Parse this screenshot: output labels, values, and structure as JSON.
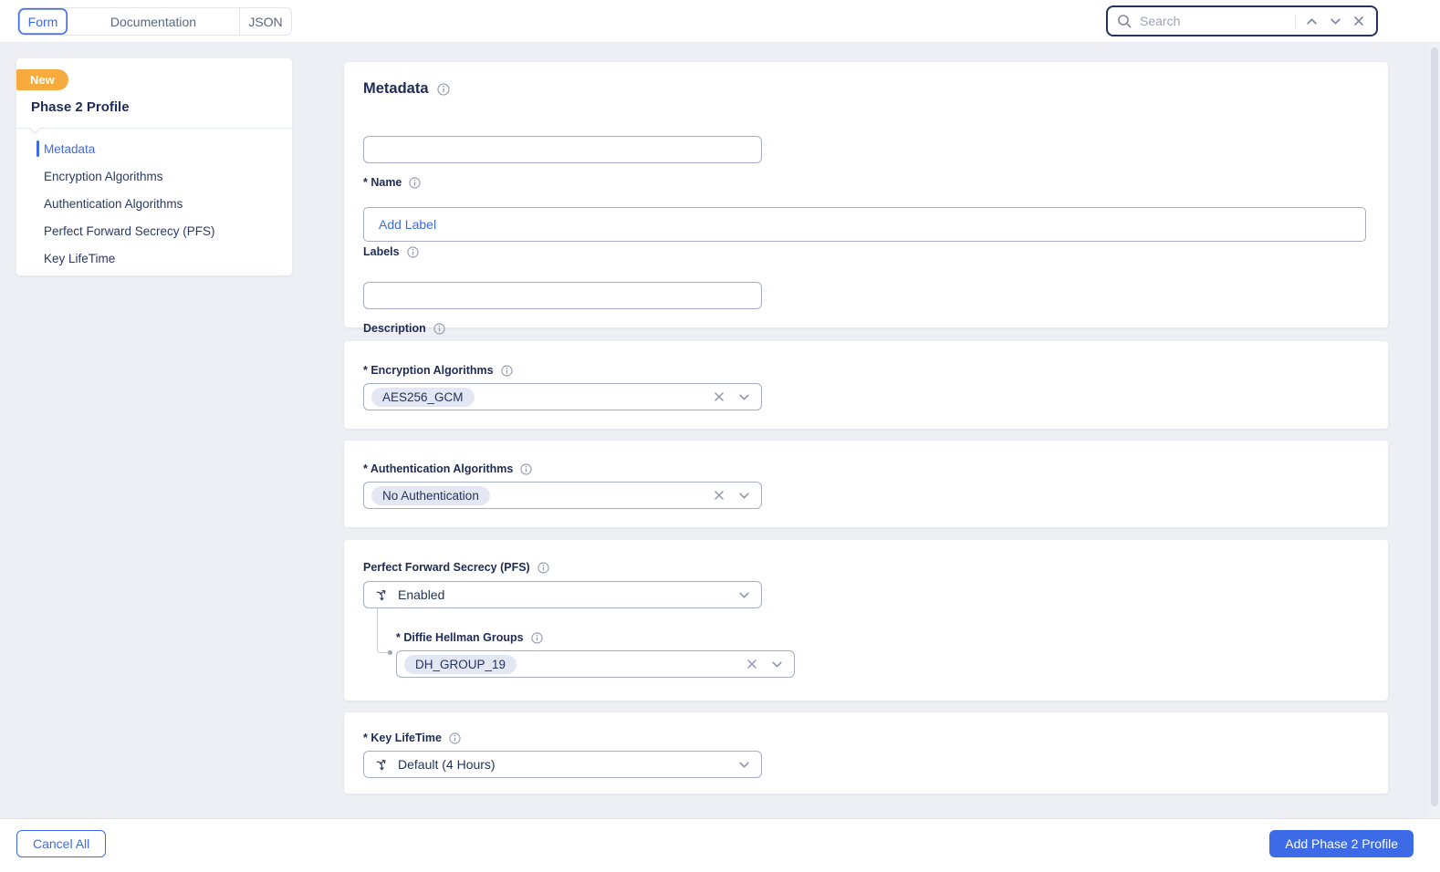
{
  "topbar": {
    "view_tabs": [
      {
        "label": "Form",
        "active": true
      },
      {
        "label": "Documentation",
        "active": false
      },
      {
        "label": "JSON",
        "active": false
      }
    ],
    "search": {
      "placeholder": "Search"
    }
  },
  "sidebar": {
    "badge": "New",
    "title": "Phase 2 Profile",
    "items": [
      {
        "label": "Metadata",
        "active": true
      },
      {
        "label": "Encryption Algorithms",
        "active": false
      },
      {
        "label": "Authentication Algorithms",
        "active": false
      },
      {
        "label": "Perfect Forward Secrecy (PFS)",
        "active": false
      },
      {
        "label": "Key LifeTime",
        "active": false
      }
    ]
  },
  "form": {
    "metadata": {
      "title": "Metadata",
      "name": {
        "label": "* Name",
        "value": ""
      },
      "labels": {
        "label": "Labels",
        "add_label": "Add Label"
      },
      "description": {
        "label": "Description",
        "value": ""
      }
    },
    "encryption": {
      "label": "* Encryption Algorithms",
      "chips": [
        "AES256_GCM"
      ]
    },
    "authentication": {
      "label": "* Authentication Algorithms",
      "chips": [
        "No Authentication"
      ]
    },
    "pfs": {
      "label": "Perfect Forward Secrecy (PFS)",
      "value": "Enabled",
      "dh_groups": {
        "label": "* Diffie Hellman Groups",
        "chips": [
          "DH_GROUP_19"
        ]
      }
    },
    "key_lifetime": {
      "label": "* Key LifeTime",
      "value": "Default (4 Hours)"
    }
  },
  "footer": {
    "cancel_label": "Cancel All",
    "submit_label": "Add Phase 2 Profile"
  },
  "colors": {
    "accent_blue": "#3d6be8",
    "badge_orange": "#f8ab3d",
    "navy_text": "#1e2b55",
    "chip_bg": "#e3e7f3",
    "page_bg": "#edeff4"
  }
}
